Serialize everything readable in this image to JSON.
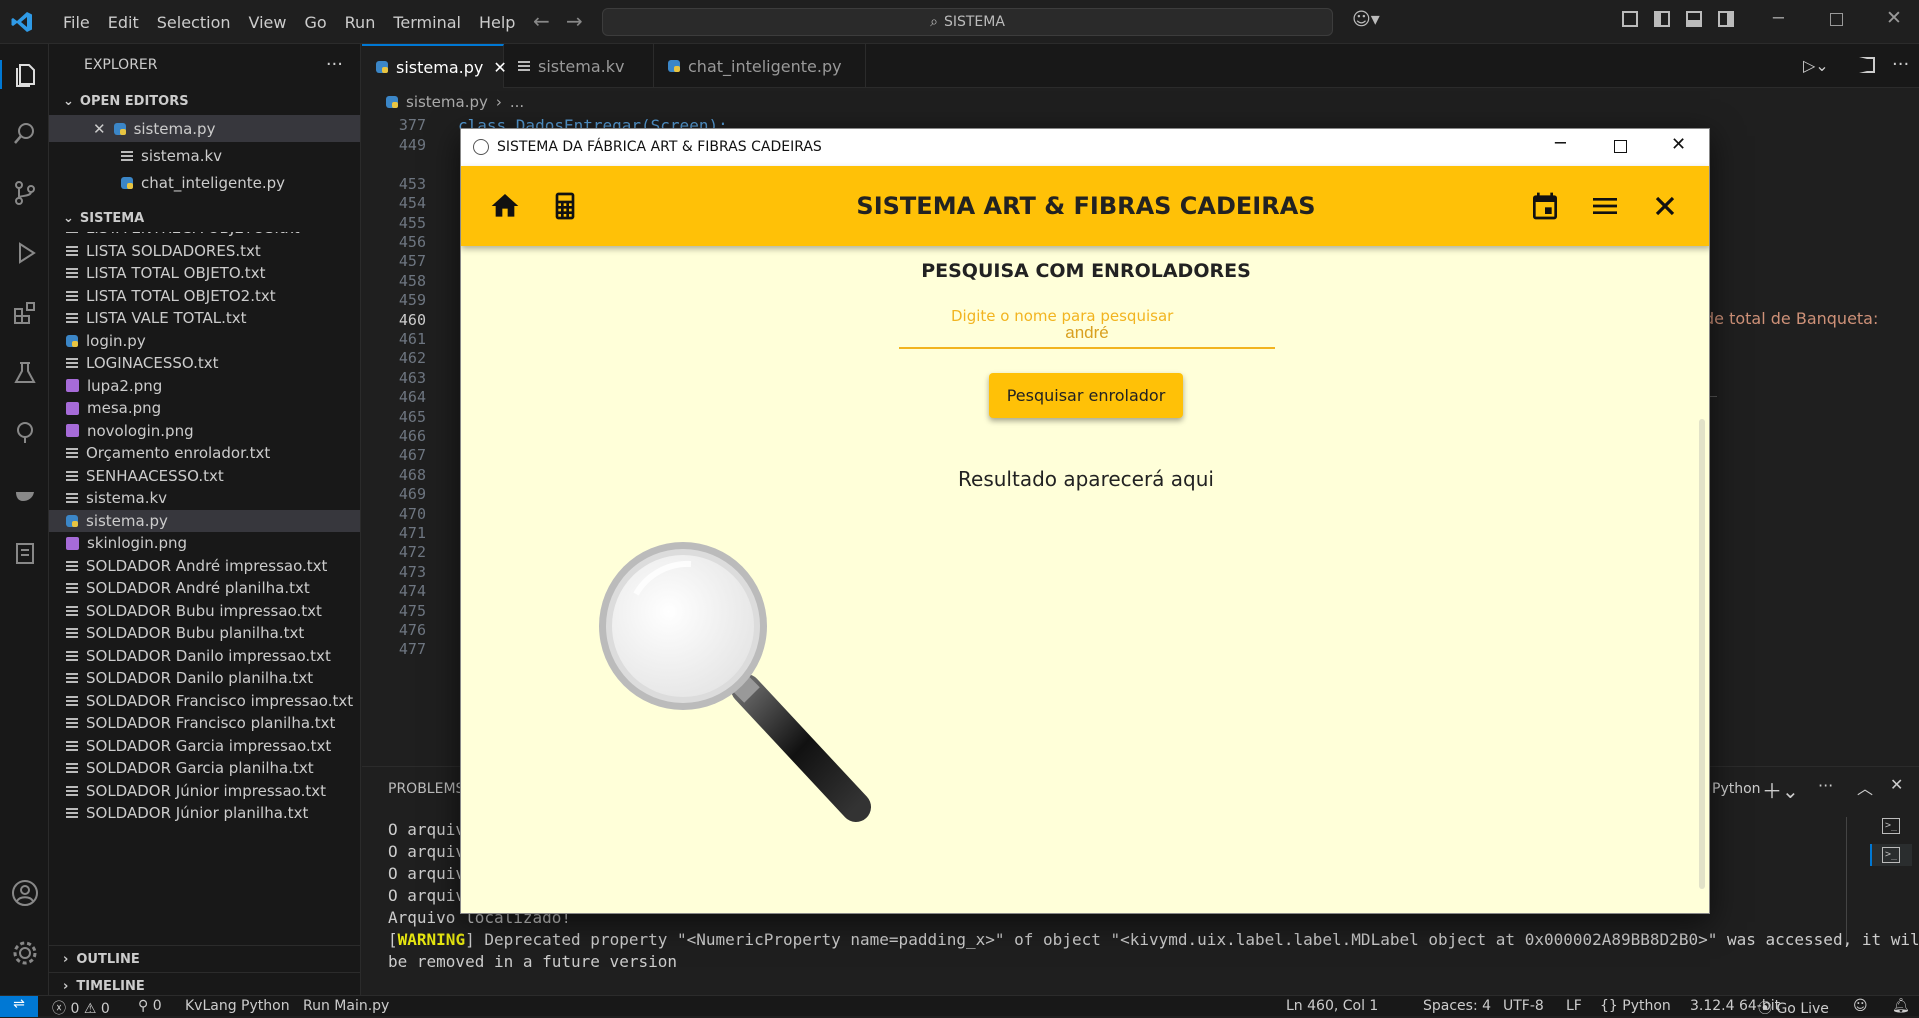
{
  "titlebar": {
    "menu": [
      "File",
      "Edit",
      "Selection",
      "View",
      "Go",
      "Run",
      "Terminal",
      "Help"
    ],
    "search": "SISTEMA"
  },
  "sidebar": {
    "explorer_title": "EXPLORER",
    "open_editors_title": "OPEN EDITORS",
    "open_editors": [
      "sistema.py",
      "sistema.kv",
      "chat_inteligente.py"
    ],
    "folder_title": "SISTEMA",
    "files": [
      {
        "name": "LISTA ENTREGA OBJETOS.txt",
        "type": "txt"
      },
      {
        "name": "LISTA SOLDADORES.txt",
        "type": "txt"
      },
      {
        "name": "LISTA TOTAL OBJETO.txt",
        "type": "txt"
      },
      {
        "name": "LISTA TOTAL OBJETO2.txt",
        "type": "txt"
      },
      {
        "name": "LISTA VALE TOTAL.txt",
        "type": "txt"
      },
      {
        "name": "login.py",
        "type": "py"
      },
      {
        "name": "LOGINACESSO.txt",
        "type": "txt"
      },
      {
        "name": "lupa2.png",
        "type": "png"
      },
      {
        "name": "mesa.png",
        "type": "png"
      },
      {
        "name": "novologin.png",
        "type": "png"
      },
      {
        "name": "Orçamento enrolador.txt",
        "type": "txt"
      },
      {
        "name": "SENHAACESSO.txt",
        "type": "txt"
      },
      {
        "name": "sistema.kv",
        "type": "txt"
      },
      {
        "name": "sistema.py",
        "type": "py"
      },
      {
        "name": "skinlogin.png",
        "type": "png"
      },
      {
        "name": "SOLDADOR André impressao.txt",
        "type": "txt"
      },
      {
        "name": "SOLDADOR André planilha.txt",
        "type": "txt"
      },
      {
        "name": "SOLDADOR Bubu impressao.txt",
        "type": "txt"
      },
      {
        "name": "SOLDADOR Bubu planilha.txt",
        "type": "txt"
      },
      {
        "name": "SOLDADOR Danilo impressao.txt",
        "type": "txt"
      },
      {
        "name": "SOLDADOR Danilo planilha.txt",
        "type": "txt"
      },
      {
        "name": "SOLDADOR Francisco impressao.txt",
        "type": "txt"
      },
      {
        "name": "SOLDADOR Francisco planilha.txt",
        "type": "txt"
      },
      {
        "name": "SOLDADOR Garcia impressao.txt",
        "type": "txt"
      },
      {
        "name": "SOLDADOR Garcia planilha.txt",
        "type": "txt"
      },
      {
        "name": "SOLDADOR Júnior impressao.txt",
        "type": "txt"
      },
      {
        "name": "SOLDADOR Júnior planilha.txt",
        "type": "txt"
      }
    ],
    "outline_title": "OUTLINE",
    "timeline_title": "TIMELINE"
  },
  "tabs": [
    "sistema.py",
    "sistema.kv",
    "chat_inteligente.py"
  ],
  "breadcrumb": {
    "file": "sistema.py",
    "rest": "..."
  },
  "editor": {
    "line_numbers": [
      "377",
      "449",
      "453",
      "454",
      "455",
      "456",
      "457",
      "458",
      "459",
      "460",
      "461",
      "462",
      "463",
      "464",
      "465",
      "466",
      "467",
      "468",
      "469",
      "470",
      "471",
      "472",
      "473",
      "474",
      "475",
      "476",
      "477"
    ],
    "current_line": "460",
    "sticky_code": "class DadosEntregar(Screen):",
    "code_fragment": "de total de Banqueta:"
  },
  "panel": {
    "problems_tab": "PROBLEMS",
    "terminal_label": "Python",
    "lines": [
      "O arquiv",
      "O arquiv",
      "O arquiv",
      "O arquiv",
      "Arquivo localizado!"
    ],
    "warning_tag": "WARNING",
    "warning_text": "] Deprecated property \"<NumericProperty name=padding_x>\" of object \"<kivymd.uix.label.label.MDLabel object at 0x000002A89BB8D2B0>\" was accessed, it will",
    "warning_text2": "be removed in a future version"
  },
  "status": {
    "errors": "0",
    "warnings": "0",
    "ports": "0",
    "kvlang": "KvLang Python",
    "run": "Run Main.py",
    "position": "Ln 460, Col 1",
    "spaces": "Spaces: 4",
    "encoding": "UTF-8",
    "eol": "LF",
    "language": "Python",
    "interpreter": "3.12.4 64-bit",
    "golive": "Go Live"
  },
  "app": {
    "window_title": "SISTEMA DA FÁBRICA ART & FIBRAS CADEIRAS",
    "heading": "SISTEMA ART & FIBRAS CADEIRAS",
    "subtitle": "PESQUISA COM ENROLADORES",
    "hint": "Digite o nome para pesquisar",
    "input_value": "andré",
    "button": "Pesquisar enrolador",
    "result": "Resultado aparecerá aqui",
    "accent": "#ffc107",
    "background": "#ffffd9"
  }
}
